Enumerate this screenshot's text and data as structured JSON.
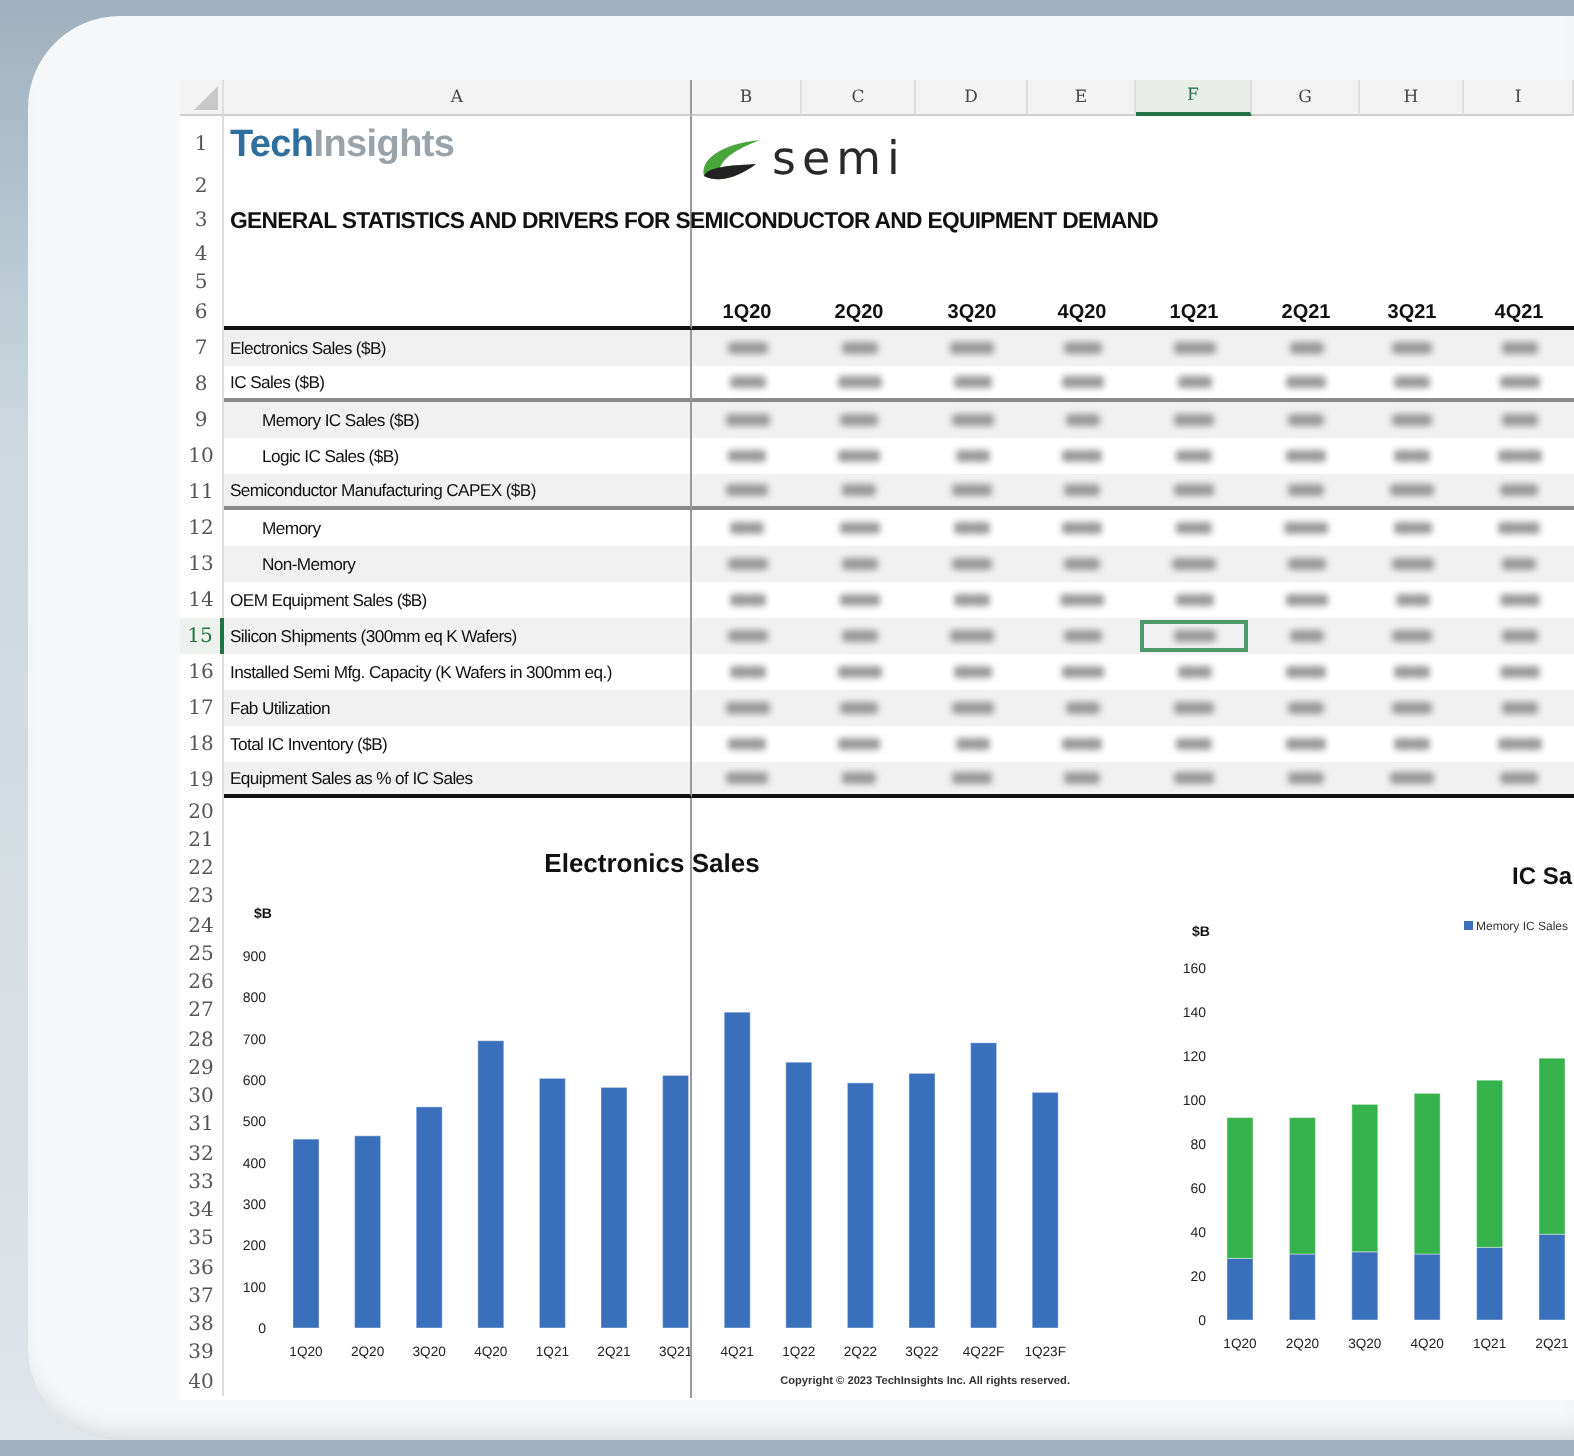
{
  "column_headers": [
    {
      "label": "A",
      "selected": false
    },
    {
      "label": "B",
      "selected": false
    },
    {
      "label": "C",
      "selected": false
    },
    {
      "label": "D",
      "selected": false
    },
    {
      "label": "E",
      "selected": false
    },
    {
      "label": "F",
      "selected": true
    },
    {
      "label": "G",
      "selected": false
    },
    {
      "label": "H",
      "selected": false
    },
    {
      "label": "I",
      "selected": false
    }
  ],
  "row_headers": [
    {
      "label": "1",
      "selected": false
    },
    {
      "label": "2",
      "selected": false
    },
    {
      "label": "3",
      "selected": false
    },
    {
      "label": "4",
      "selected": false
    },
    {
      "label": "5",
      "selected": false
    },
    {
      "label": "6",
      "selected": false
    },
    {
      "label": "7",
      "selected": false
    },
    {
      "label": "8",
      "selected": false
    },
    {
      "label": "9",
      "selected": false
    },
    {
      "label": "10",
      "selected": false
    },
    {
      "label": "11",
      "selected": false
    },
    {
      "label": "12",
      "selected": false
    },
    {
      "label": "13",
      "selected": false
    },
    {
      "label": "14",
      "selected": false
    },
    {
      "label": "15",
      "selected": true
    },
    {
      "label": "16",
      "selected": false
    },
    {
      "label": "17",
      "selected": false
    },
    {
      "label": "18",
      "selected": false
    },
    {
      "label": "19",
      "selected": false
    },
    {
      "label": "20",
      "selected": false
    },
    {
      "label": "21",
      "selected": false
    },
    {
      "label": "22",
      "selected": false
    },
    {
      "label": "23",
      "selected": false
    },
    {
      "label": "24",
      "selected": false
    },
    {
      "label": "25",
      "selected": false
    },
    {
      "label": "26",
      "selected": false
    },
    {
      "label": "27",
      "selected": false
    },
    {
      "label": "28",
      "selected": false
    },
    {
      "label": "29",
      "selected": false
    },
    {
      "label": "30",
      "selected": false
    },
    {
      "label": "31",
      "selected": false
    },
    {
      "label": "32",
      "selected": false
    },
    {
      "label": "33",
      "selected": false
    },
    {
      "label": "34",
      "selected": false
    },
    {
      "label": "35",
      "selected": false
    },
    {
      "label": "36",
      "selected": false
    },
    {
      "label": "37",
      "selected": false
    },
    {
      "label": "38",
      "selected": false
    },
    {
      "label": "39",
      "selected": false
    },
    {
      "label": "40",
      "selected": false
    }
  ],
  "brand": {
    "first": "Tech",
    "second": "Insights"
  },
  "partner_logo": "semi",
  "sheet_title": "GENERAL STATISTICS AND DRIVERS FOR SEMICONDUCTOR AND EQUIPMENT DEMAND",
  "quarters": [
    "1Q20",
    "2Q20",
    "3Q20",
    "4Q20",
    "1Q21",
    "2Q21",
    "3Q21",
    "4Q21"
  ],
  "metrics": [
    {
      "label": "Electronics Sales ($B)"
    },
    {
      "label": "IC Sales ($B)",
      "children": [
        {
          "label": "Memory IC Sales ($B)"
        },
        {
          "label": "Logic IC Sales ($B)"
        }
      ]
    },
    {
      "label": "Semiconductor Manufacturing CAPEX ($B)",
      "children": [
        {
          "label": "Memory"
        },
        {
          "label": "Non-Memory"
        }
      ]
    },
    {
      "label": "OEM Equipment Sales ($B)"
    },
    {
      "label": "Silicon Shipments (300mm eq K Wafers)"
    },
    {
      "label": "Installed Semi Mfg. Capacity (K Wafers in 300mm eq.)"
    },
    {
      "label": "Fab Utilization"
    },
    {
      "label": "Total IC Inventory ($B)"
    },
    {
      "label": "Equipment Sales as % of IC Sales"
    }
  ],
  "charts": [
    {
      "chart_data": {
        "type": "bar",
        "title": "Electronics Sales",
        "ylabel": "$B",
        "categories": [
          "1Q20",
          "2Q20",
          "3Q20",
          "4Q20",
          "1Q21",
          "2Q21",
          "3Q21",
          "4Q21",
          "1Q22",
          "2Q22",
          "3Q22",
          "4Q22F",
          "1Q23F"
        ],
        "series": [
          {
            "color": "#3a6fbb",
            "values": [
              457,
              465,
              535,
              695,
              604,
              582,
              611,
              764,
              643,
              593,
              616,
              690,
              570
            ]
          }
        ],
        "ylim": [
          0,
          900
        ],
        "yticks": [
          0,
          100,
          200,
          300,
          400,
          500,
          600,
          700,
          800,
          900
        ]
      },
      "copyright": "Copyright © 2023 TechInsights Inc.  All rights reserved."
    },
    {
      "chart_data": {
        "type": "bar",
        "stacked": true,
        "title": "IC Sa",
        "ylabel": "$B",
        "categories": [
          "1Q20",
          "2Q20",
          "3Q20",
          "4Q20",
          "1Q21",
          "2Q21"
        ],
        "series": [
          {
            "name": "Memory IC Sales",
            "color": "#3a6fbb",
            "values": [
              28,
              30,
              31,
              30,
              33,
              39
            ]
          },
          {
            "color": "#35b24b",
            "values": [
              64,
              62,
              67,
              73,
              76,
              80
            ]
          }
        ],
        "ylim": [
          0,
          160
        ],
        "yticks": [
          0,
          20,
          40,
          60,
          80,
          100,
          120,
          140,
          160
        ]
      }
    }
  ]
}
